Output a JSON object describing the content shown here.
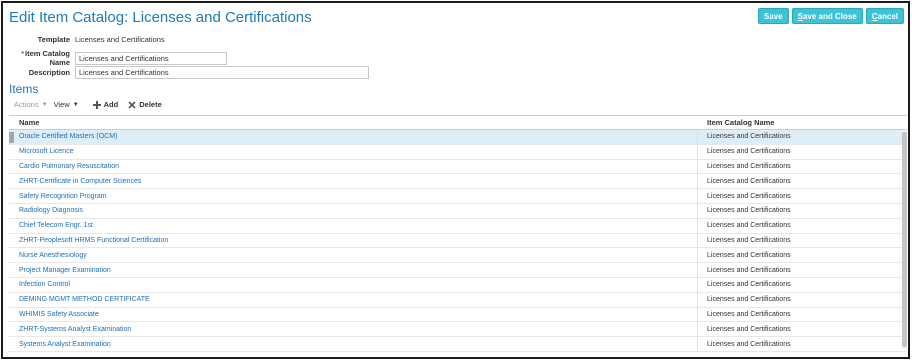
{
  "header": {
    "title": "Edit Item Catalog: Licenses and Certifications",
    "buttons": {
      "save": "Save",
      "save_close_prefix": "S",
      "save_close_rest": "ave and Close",
      "cancel_prefix": "C",
      "cancel_rest": "ancel"
    }
  },
  "form": {
    "template_label": "Template",
    "template_value": "Licenses and Certifications",
    "required_marker": "*",
    "name_label": "Item Catalog Name",
    "name_value": "Licenses and Certifications",
    "description_label": "Description",
    "description_value": "Licenses and Certifications"
  },
  "items": {
    "title": "Items",
    "toolbar": {
      "actions": "Actions",
      "view": "View",
      "add": "Add",
      "delete": "Delete"
    },
    "columns": {
      "name": "Name",
      "catalog": "Item Catalog Name"
    },
    "rows": [
      {
        "name": "Oracle Certified Masters (OCM)",
        "catalog": "Licenses and Certifications"
      },
      {
        "name": "Microsoft Licence",
        "catalog": "Licenses and Certifications"
      },
      {
        "name": "Cardio Pulmonary Resuscitation",
        "catalog": "Licenses and Certifications"
      },
      {
        "name": "ZHRT-Certificate in Computer Sciences",
        "catalog": "Licenses and Certifications"
      },
      {
        "name": "Safety Recognition Program",
        "catalog": "Licenses and Certifications"
      },
      {
        "name": "Radiology Diagnosis",
        "catalog": "Licenses and Certifications"
      },
      {
        "name": "Chief Telecom Engr. 1st",
        "catalog": "Licenses and Certifications"
      },
      {
        "name": "ZHRT-Peoplesoft HRMS Functional Certification",
        "catalog": "Licenses and Certifications"
      },
      {
        "name": "Nurse Anesthesiology",
        "catalog": "Licenses and Certifications"
      },
      {
        "name": "Project Manager Examination",
        "catalog": "Licenses and Certifications"
      },
      {
        "name": "Infection Control",
        "catalog": "Licenses and Certifications"
      },
      {
        "name": "DEMING MGMT METHOD CERTIFICATE",
        "catalog": "Licenses and Certifications"
      },
      {
        "name": "WHIMIS Safety Associate",
        "catalog": "Licenses and Certifications"
      },
      {
        "name": "ZHRT-Systems Analyst Examination",
        "catalog": "Licenses and Certifications"
      },
      {
        "name": "Systems Analyst Examination",
        "catalog": "Licenses and Certifications"
      }
    ]
  },
  "colors": {
    "title_blue": "#1e7ab8",
    "button_teal": "#3cc3d6",
    "selected_row": "#deeef9"
  }
}
